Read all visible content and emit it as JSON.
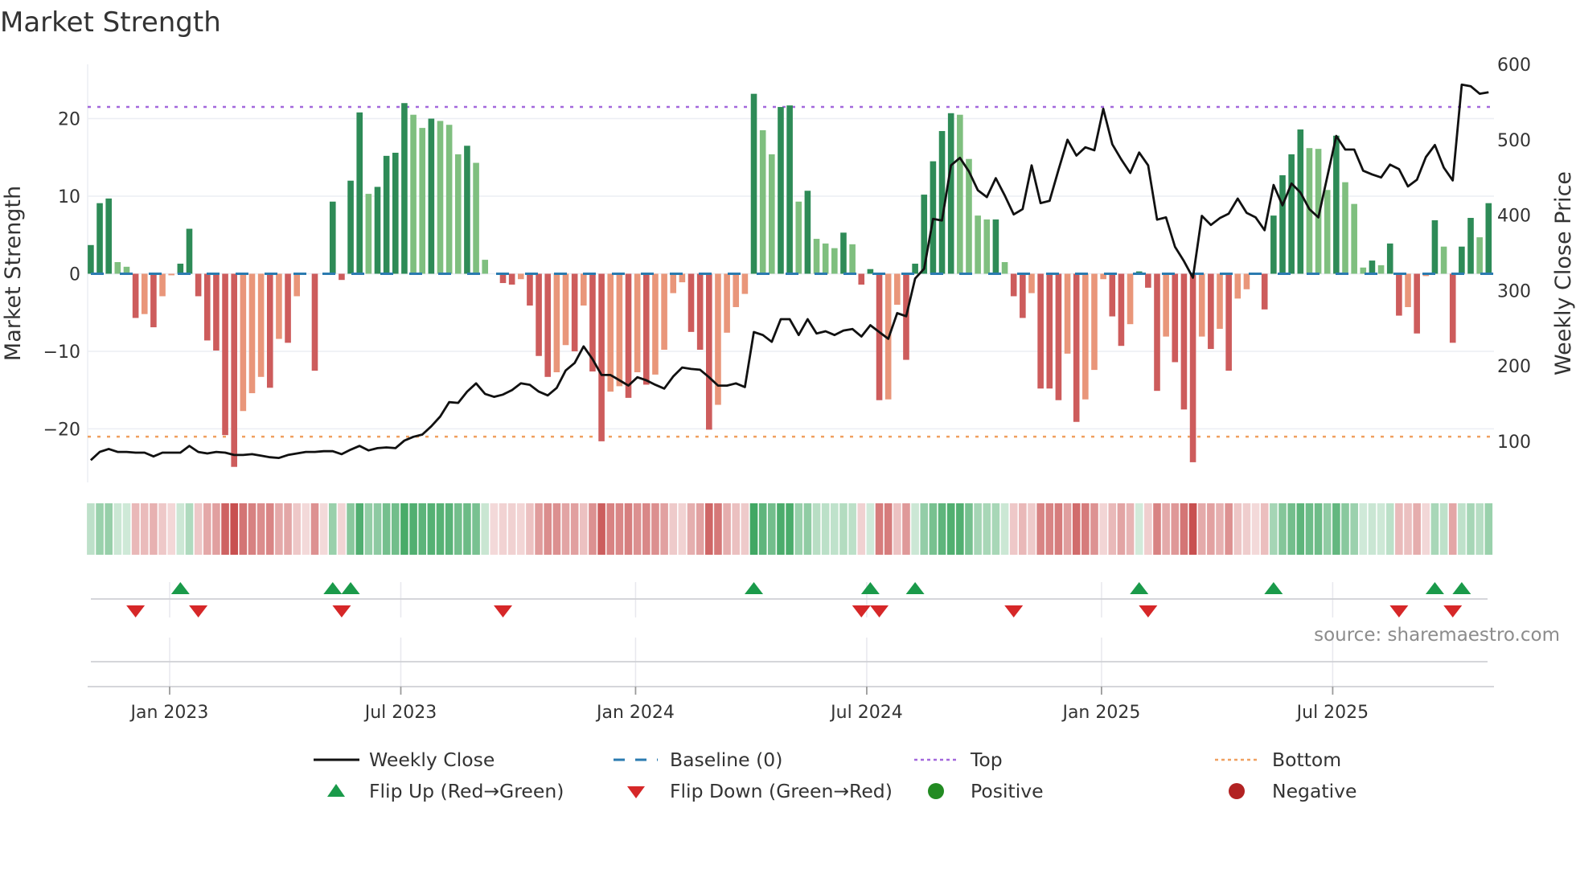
{
  "chart_data": {
    "type": "bar+line",
    "title": "Market Strength",
    "ylabel_left": "Market Strength",
    "ylabel_right": "Weekly Close Price",
    "x_unit": "week index",
    "xlim": [
      -0.35,
      156.6
    ],
    "strength_ylim": [
      -26.9,
      27.0
    ],
    "price_ylim": [
      45.6,
      600
    ],
    "strength_ticks": [
      {
        "value": 20,
        "label": "20"
      },
      {
        "value": 10,
        "label": "10"
      },
      {
        "value": 0,
        "label": "0"
      },
      {
        "value": -10,
        "label": "−10"
      },
      {
        "value": -20,
        "label": "−20"
      }
    ],
    "price_ticks": [
      {
        "value": 600,
        "label": "600"
      },
      {
        "value": 500,
        "label": "500"
      },
      {
        "value": 400,
        "label": "400"
      },
      {
        "value": 300,
        "label": "300"
      },
      {
        "value": 200,
        "label": "200"
      },
      {
        "value": 100,
        "label": "100"
      }
    ],
    "date_ticks": [
      {
        "week": 8.8,
        "label": "Jan 2023"
      },
      {
        "week": 34.6,
        "label": "Jul 2023"
      },
      {
        "week": 60.8,
        "label": "Jan 2024"
      },
      {
        "week": 86.6,
        "label": "Jul 2024"
      },
      {
        "week": 112.8,
        "label": "Jan 2025"
      },
      {
        "week": 138.6,
        "label": "Jul 2025"
      }
    ],
    "top_level": 21.5,
    "bottom_level": -21.0,
    "baseline": 0,
    "strength": [
      3.7,
      9.1,
      9.7,
      1.5,
      0.9,
      -5.7,
      -5.2,
      -6.9,
      -2.9,
      -0.2,
      1.3,
      5.8,
      -2.9,
      -8.6,
      -9.9,
      -20.8,
      -24.9,
      -17.7,
      -15.4,
      -13.3,
      -14.7,
      -8.4,
      -8.9,
      -2.9,
      0,
      -12.5,
      0,
      9.3,
      -0.8,
      12,
      20.8,
      10.3,
      11.2,
      15.2,
      15.6,
      22,
      20.5,
      18.8,
      20,
      19.7,
      19.2,
      15.4,
      16.5,
      14.3,
      1.8,
      0,
      -1.2,
      -1.4,
      -0.7,
      -4.1,
      -10.6,
      -13.3,
      -12.7,
      -9.2,
      -10,
      -4.1,
      -12.6,
      -21.6,
      -15.2,
      -14.5,
      -16,
      -12.7,
      -14.3,
      -13,
      -9.8,
      -2.5,
      -1.1,
      -7.5,
      -9.8,
      -20.1,
      -16.9,
      -7.6,
      -4.3,
      -2.6,
      23.2,
      18.5,
      15.4,
      21.5,
      21.7,
      9.3,
      10.7,
      4.5,
      3.9,
      3.3,
      5.3,
      3.8,
      -1.4,
      0.6,
      -16.3,
      -16.2,
      -4,
      -11.1,
      1.3,
      10.2,
      14.5,
      18.4,
      20.7,
      20.5,
      14.8,
      7.5,
      7,
      7,
      1.5,
      -2.9,
      -5.7,
      -2.5,
      -14.8,
      -14.8,
      -16.3,
      -10.3,
      -19.1,
      -16.2,
      -12.4,
      -0.7,
      -5.5,
      -9.3,
      -6.5,
      0.3,
      -1.8,
      -15.1,
      -8.1,
      -11.4,
      -17.5,
      -24.3,
      -8.1,
      -9.7,
      -7.1,
      -12.5,
      -3.2,
      -2,
      0,
      -4.6,
      7.5,
      12.7,
      15.4,
      18.6,
      16.2,
      16.1,
      10.8,
      17.8,
      11.8,
      9,
      0.8,
      1.7,
      1.1,
      3.9,
      -5.4,
      -4.3,
      -7.7,
      -0.3,
      6.9,
      3.5,
      -8.9,
      3.5,
      7.2,
      4.7,
      9.1
    ],
    "strength_rising": [
      1,
      1,
      1,
      0,
      0,
      1,
      0,
      1,
      0,
      0,
      1,
      1,
      1,
      1,
      1,
      1,
      1,
      0,
      0,
      0,
      1,
      0,
      1,
      0,
      0,
      1,
      0,
      1,
      1,
      1,
      1,
      0,
      1,
      1,
      1,
      1,
      0,
      0,
      1,
      0,
      0,
      0,
      1,
      0,
      0,
      0,
      1,
      1,
      0,
      1,
      1,
      1,
      0,
      0,
      1,
      0,
      1,
      1,
      0,
      0,
      1,
      0,
      1,
      0,
      0,
      0,
      0,
      1,
      1,
      1,
      0,
      0,
      0,
      0,
      1,
      0,
      0,
      1,
      1,
      0,
      1,
      0,
      0,
      0,
      1,
      0,
      1,
      1,
      1,
      0,
      0,
      1,
      1,
      1,
      1,
      1,
      1,
      0,
      0,
      0,
      0,
      1,
      0,
      1,
      1,
      0,
      1,
      1,
      1,
      0,
      1,
      0,
      0,
      0,
      1,
      1,
      0,
      1,
      1,
      1,
      0,
      1,
      1,
      1,
      0,
      1,
      0,
      1,
      0,
      0,
      0,
      1,
      1,
      1,
      1,
      1,
      0,
      0,
      0,
      1,
      0,
      0,
      0,
      1,
      0,
      1,
      1,
      0,
      1,
      0,
      1,
      0,
      1,
      1,
      1,
      0,
      1
    ],
    "weekly_close": [
      75,
      86,
      90,
      86,
      86,
      85,
      85,
      80,
      85,
      85,
      85,
      94,
      86,
      84,
      86,
      85,
      82,
      82,
      83,
      81,
      79,
      78,
      82,
      84,
      86,
      86,
      87,
      87,
      83,
      89,
      94,
      88,
      91,
      92,
      91,
      101,
      106,
      109,
      120,
      133,
      152,
      151,
      166,
      177,
      163,
      159,
      162,
      168,
      177,
      175,
      166,
      161,
      171,
      194,
      204,
      226,
      209,
      188,
      188,
      181,
      174,
      185,
      181,
      175,
      170,
      186,
      198,
      196,
      195,
      185,
      174,
      174,
      177,
      172,
      245,
      241,
      232,
      262,
      262,
      241,
      262,
      243,
      246,
      241,
      247,
      249,
      239,
      254,
      245,
      236,
      270,
      266,
      316,
      329,
      395,
      393,
      466,
      476,
      458,
      433,
      424,
      449,
      426,
      401,
      408,
      466,
      416,
      419,
      460,
      500,
      479,
      490,
      486,
      541,
      494,
      474,
      456,
      483,
      466,
      394,
      397,
      358,
      339,
      317,
      399,
      387,
      396,
      402,
      422,
      403,
      397,
      380,
      440,
      413,
      442,
      430,
      408,
      397,
      451,
      505,
      487,
      487,
      459,
      454,
      450,
      467,
      461,
      438,
      447,
      477,
      493,
      463,
      446,
      573,
      571,
      561,
      563
    ],
    "flip_up_weeks": [
      10,
      27,
      29,
      74,
      87,
      92,
      117,
      132,
      150,
      153
    ],
    "flip_down_weeks": [
      5,
      12,
      28,
      46,
      86,
      88,
      103,
      118,
      146,
      152
    ],
    "colors": {
      "bar_pos_strong": "#2e8b57",
      "bar_pos_weak": "#7fbf7f",
      "bar_neg_strong": "#cd5c5c",
      "bar_neg_weak": "#e9967a",
      "price_line": "#111111",
      "baseline": "#2b7bb0",
      "top": "#a368dc",
      "bottom": "#f0a060",
      "flip_up": "#1a9a4a",
      "flip_down": "#d62728",
      "positive": "#228b22",
      "negative": "#b22222"
    }
  },
  "legend": {
    "weekly_close": "Weekly Close",
    "baseline": "Baseline (0)",
    "top": "Top",
    "bottom": "Bottom",
    "flip_up": "Flip Up (Red→Green)",
    "flip_down": "Flip Down (Green→Red)",
    "positive": "Positive",
    "negative": "Negative"
  },
  "source": "source: sharemaestro.com"
}
